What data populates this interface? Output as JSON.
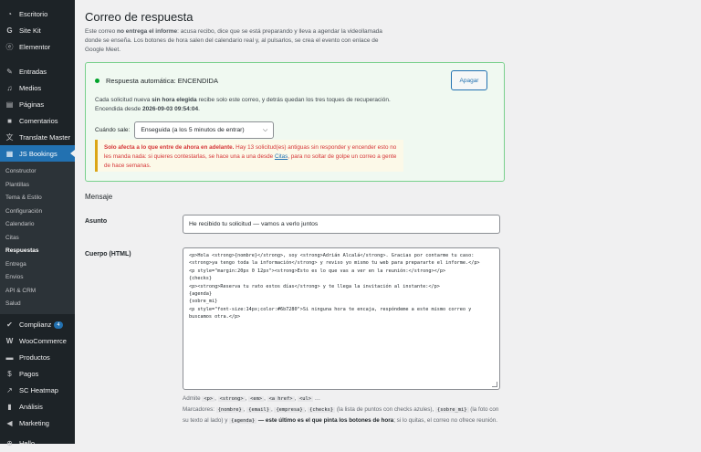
{
  "sidebar": {
    "top_items": [
      {
        "label": "Escritorio",
        "icon": "dashboard-icon"
      },
      {
        "label": "Site Kit",
        "icon": "sitekit-icon"
      },
      {
        "label": "Elementor",
        "icon": "elementor-icon"
      }
    ],
    "mid_items": [
      {
        "label": "Entradas",
        "icon": "pin-icon"
      },
      {
        "label": "Medios",
        "icon": "media-icon"
      },
      {
        "label": "Páginas",
        "icon": "pages-icon"
      },
      {
        "label": "Comentarios",
        "icon": "comments-icon"
      },
      {
        "label": "Translate Master",
        "icon": "translate-icon"
      },
      {
        "label": "JS Bookings",
        "icon": "calendar-icon"
      }
    ],
    "sub_items": [
      "Constructor",
      "Plantillas",
      "Tema & Estilo",
      "Configuración",
      "Calendario",
      "Citas",
      "Respuestas",
      "Entrega",
      "Envios",
      "API & CRM",
      "Salud"
    ],
    "bottom_items": [
      {
        "label": "Complianz",
        "icon": "check-icon",
        "badge": "4"
      },
      {
        "label": "WooCommerce",
        "icon": "woo-icon"
      },
      {
        "label": "Productos",
        "icon": "products-icon"
      },
      {
        "label": "Pagos",
        "icon": "payments-icon"
      },
      {
        "label": "SC Heatmap",
        "icon": "heatmap-icon"
      },
      {
        "label": "Análisis",
        "icon": "chart-icon"
      },
      {
        "label": "Marketing",
        "icon": "megaphone-icon"
      },
      {
        "label": "Hello",
        "icon": "plus-icon"
      }
    ]
  },
  "page": {
    "title": "Correo de respuesta",
    "intro_1": "Este correo ",
    "intro_strong": "no entrega el informe",
    "intro_2": ": acusa recibo, dice que se está preparando y lleva a agendar la videollamada donde se enseña. Los botones de hora salen del calendario real y, al pulsarlos, se crea el evento con enlace de Google Meet."
  },
  "status_card": {
    "status": "Respuesta automática: ENCENDIDA",
    "status_color": "#00a32a",
    "button": "Apagar",
    "desc_1": "Cada solicitud nueva ",
    "desc_strong": "sin hora elegida",
    "desc_2": " recibe solo este correo, y detrás quedan los tres toques de recuperación.",
    "since_label": "Encendida desde ",
    "since_value": "2026-09-03 09:54:04",
    "since_end": ".",
    "when_label": "Cuándo sale:",
    "when_value": "Enseguida (a los 5 minutos de entrar)",
    "warn_strong": "Solo afecta a lo que entre de ahora en adelante.",
    "warn_1": " Hay 13 solicitud(es) antiguas sin responder y encender esto no les manda nada: si quieres contestarlas, se hace una a una desde ",
    "warn_link": "Citas",
    "warn_2": ", para no soltar de golpe un correo a gente de hace semanas."
  },
  "message": {
    "heading": "Mensaje",
    "subject_label": "Asunto",
    "subject_value": "He recibido tu solicitud — vamos a verlo juntos",
    "body_label": "Cuerpo (HTML)",
    "body_value": "<p>Hola <strong>{nombre}</strong>, soy <strong>Adrián Alcalá</strong>. Gracias por contarme tu caso: <strong>ya tengo toda la información</strong> y reviso yo mismo tu web para prepararte el informe.</p>\n<p style=\"margin:20px 0 12px\"><strong>Esto es lo que vas a ver en la reunión:</strong></p>\n{checks}\n<p><strong>Reserva tu rato estos días</strong> y te llega la invitación al instante:</p>\n{agenda}\n{sobre_mi}\n<p style=\"font-size:14px;color:#6b7280\">Si ninguna hora te encaja, respóndeme a este mismo correo y buscamos otra.</p>"
  },
  "help": {
    "admite": "Admite",
    "tags": [
      "<p>",
      "<strong>",
      "<em>",
      "<a href>",
      "<ul>"
    ],
    "tags_end": "…",
    "marcadores": "Marcadores:",
    "m1": "{nombre}",
    "m2": "{email}",
    "m3": "{empresa}",
    "m4": "{checks}",
    "m4_desc": "(la lista de puntos con checks azules),",
    "m5": "{sobre_mi}",
    "m5_desc": "(la foto con su texto al lado) y",
    "m6": "{agenda}",
    "m6_strong": "— este último es el que pinta los botones de hora",
    "m6_end": "; si lo quitas, el correo no ofrece reunión."
  }
}
